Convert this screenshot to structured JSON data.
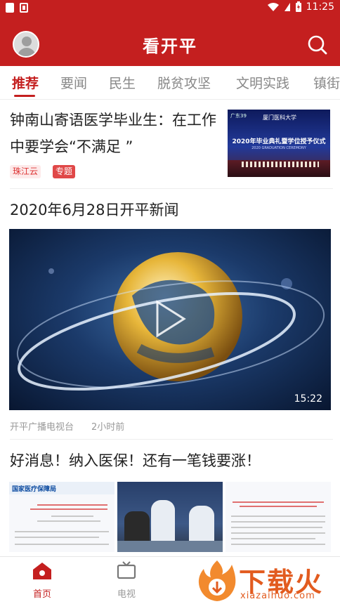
{
  "status_bar": {
    "time": "11:25"
  },
  "header": {
    "title": "看开平"
  },
  "tabs": [
    "推荐",
    "要闻",
    "民生",
    "脱贫攻坚",
    "文明实践",
    "镇街"
  ],
  "feed": {
    "item1": {
      "title": "钟南山寄语医学毕业生：在工作中要学会“不满足 ”",
      "tag_source": "珠江云",
      "tag_special": "专题",
      "thumb_logo": "广东39",
      "thumb_school": "厦门医科大学",
      "thumb_caption": "2020年毕业典礼暨学位授予仪式",
      "thumb_caption_en": "2020 GRADUATION CEREMONY"
    },
    "item2": {
      "title": "2020年6月28日开平新闻",
      "duration": "15:22",
      "source": "开平广播电视台",
      "time": "2小时前"
    },
    "item3": {
      "title": "好消息！纳入医保！还有一笔钱要涨！",
      "doc_logo": "国家医疗保障局"
    }
  },
  "bottom_nav": [
    {
      "label": "首页",
      "icon": "home-icon",
      "active": true
    },
    {
      "label": "电视",
      "icon": "tv-icon",
      "active": false
    }
  ],
  "watermark": {
    "text": "下载火",
    "sub": "xiazaihuo.com"
  },
  "colors": {
    "brand": "#c41f1f",
    "tag_source_text": "#d33",
    "tag_special_bg": "#e04848",
    "watermark": "#e25b1f"
  }
}
